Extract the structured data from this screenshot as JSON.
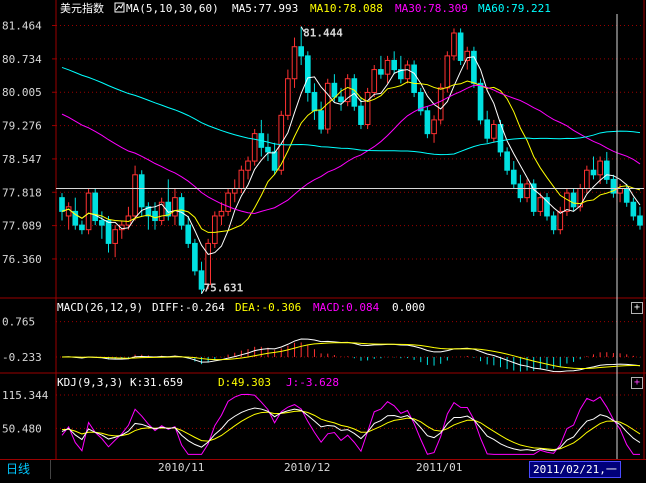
{
  "main": {
    "name": "美元指数",
    "ma_label": "MA(5,10,30,60)",
    "ma5": "MA5:77.993",
    "ma10": "MA10:78.088",
    "ma30": "MA30:78.309",
    "ma60": "MA60:79.221",
    "y_ticks": [
      "81.464",
      "80.734",
      "80.005",
      "79.276",
      "78.547",
      "77.818",
      "77.089",
      "76.360"
    ],
    "high_label": "81.444",
    "low_label": "75.631"
  },
  "macd": {
    "label": "MACD(26,12,9)",
    "diff": "DIFF:-0.264",
    "dea": "DEA:-0.306",
    "macd": "MACD:0.084",
    "extra": "0.000",
    "y_ticks": [
      "0.765",
      "-0.233"
    ]
  },
  "kdj": {
    "label": "KDJ(9,3,3)",
    "k": "K:31.659",
    "d": "D:49.303",
    "j": "J:-3.628",
    "y_ticks": [
      "115.344",
      "50.480"
    ]
  },
  "status": {
    "period": "日线",
    "x_labels": [
      "2010/11",
      "2010/12",
      "2011/01"
    ],
    "cursor_date": "2011/02/21,一"
  },
  "colors": {
    "up": "#ff3232",
    "down": "#00e0e0",
    "ma5": "#ffffff",
    "ma10": "#ffff00",
    "ma30": "#ff00ff",
    "ma60": "#00ffff",
    "grid": "#9a0000"
  },
  "chart_data": [
    {
      "type": "candlestick",
      "title": "美元指数",
      "ylim": [
        75.6,
        81.6
      ],
      "ohlc": [
        [
          77.7,
          77.8,
          77.2,
          77.4
        ],
        [
          77.3,
          77.6,
          77.0,
          77.5
        ],
        [
          77.4,
          77.7,
          77.0,
          77.1
        ],
        [
          77.1,
          77.2,
          76.9,
          77.0
        ],
        [
          77.0,
          77.9,
          76.9,
          77.8
        ],
        [
          77.8,
          77.9,
          77.1,
          77.2
        ],
        [
          77.2,
          77.4,
          76.8,
          77.1
        ],
        [
          77.2,
          77.3,
          76.5,
          76.7
        ],
        [
          76.7,
          77.1,
          76.4,
          77.0
        ],
        [
          77.0,
          77.2,
          76.8,
          77.1
        ],
        [
          77.1,
          77.5,
          77.0,
          77.3
        ],
        [
          77.3,
          78.4,
          77.2,
          78.2
        ],
        [
          78.2,
          78.3,
          77.3,
          77.5
        ],
        [
          77.5,
          77.6,
          77.0,
          77.3
        ],
        [
          77.4,
          77.6,
          77.0,
          77.2
        ],
        [
          77.2,
          77.7,
          77.1,
          77.6
        ],
        [
          77.6,
          78.1,
          77.2,
          77.3
        ],
        [
          77.3,
          77.9,
          77.1,
          77.7
        ],
        [
          77.7,
          77.8,
          77.0,
          77.1
        ],
        [
          77.1,
          77.3,
          76.6,
          76.7
        ],
        [
          76.7,
          76.8,
          76.0,
          76.1
        ],
        [
          76.1,
          76.3,
          75.6,
          75.7
        ],
        [
          75.8,
          76.8,
          75.7,
          76.7
        ],
        [
          76.7,
          77.4,
          76.6,
          77.3
        ],
        [
          77.3,
          77.6,
          77.1,
          77.4
        ],
        [
          77.4,
          77.9,
          77.3,
          77.8
        ],
        [
          77.8,
          78.1,
          77.6,
          77.9
        ],
        [
          77.9,
          78.4,
          77.8,
          78.3
        ],
        [
          78.3,
          78.6,
          78.1,
          78.5
        ],
        [
          78.5,
          79.2,
          78.4,
          79.1
        ],
        [
          79.1,
          79.4,
          78.6,
          78.8
        ],
        [
          78.8,
          79.1,
          78.5,
          78.7
        ],
        [
          78.7,
          78.9,
          78.2,
          78.3
        ],
        [
          78.3,
          79.6,
          78.2,
          79.5
        ],
        [
          79.5,
          80.5,
          79.4,
          80.3
        ],
        [
          80.3,
          81.2,
          80.1,
          81.0
        ],
        [
          81.0,
          81.44,
          80.6,
          80.8
        ],
        [
          80.8,
          80.9,
          79.8,
          80.0
        ],
        [
          80.0,
          80.2,
          79.4,
          79.6
        ],
        [
          79.6,
          79.8,
          79.1,
          79.2
        ],
        [
          79.2,
          80.3,
          79.1,
          80.2
        ],
        [
          80.2,
          80.4,
          79.8,
          79.9
        ],
        [
          79.9,
          80.1,
          79.6,
          79.8
        ],
        [
          79.8,
          80.4,
          79.7,
          80.3
        ],
        [
          80.3,
          80.4,
          79.6,
          79.7
        ],
        [
          79.7,
          79.9,
          79.2,
          79.3
        ],
        [
          79.3,
          80.1,
          79.2,
          80.0
        ],
        [
          80.0,
          80.6,
          79.9,
          80.5
        ],
        [
          80.5,
          80.8,
          80.3,
          80.4
        ],
        [
          80.4,
          80.8,
          80.2,
          80.7
        ],
        [
          80.7,
          80.9,
          80.4,
          80.5
        ],
        [
          80.5,
          80.8,
          80.2,
          80.3
        ],
        [
          80.3,
          80.7,
          80.2,
          80.6
        ],
        [
          80.6,
          80.7,
          79.9,
          80.0
        ],
        [
          80.0,
          80.1,
          79.5,
          79.6
        ],
        [
          79.6,
          79.7,
          79.0,
          79.1
        ],
        [
          79.1,
          79.5,
          78.9,
          79.4
        ],
        [
          79.4,
          80.2,
          79.3,
          80.1
        ],
        [
          80.1,
          80.9,
          80.0,
          80.8
        ],
        [
          80.8,
          81.4,
          80.7,
          81.3
        ],
        [
          81.3,
          81.4,
          80.6,
          80.7
        ],
        [
          80.7,
          81.0,
          80.5,
          80.9
        ],
        [
          80.9,
          81.0,
          80.1,
          80.2
        ],
        [
          80.2,
          80.3,
          79.3,
          79.4
        ],
        [
          79.4,
          79.6,
          78.9,
          79.0
        ],
        [
          79.0,
          79.4,
          78.9,
          79.3
        ],
        [
          79.3,
          79.4,
          78.6,
          78.7
        ],
        [
          78.7,
          78.8,
          78.2,
          78.3
        ],
        [
          78.3,
          78.5,
          77.9,
          78.0
        ],
        [
          78.0,
          78.2,
          77.6,
          77.7
        ],
        [
          77.7,
          78.1,
          77.6,
          78.0
        ],
        [
          78.0,
          78.1,
          77.3,
          77.4
        ],
        [
          77.4,
          77.8,
          77.3,
          77.7
        ],
        [
          77.7,
          77.8,
          77.2,
          77.3
        ],
        [
          77.3,
          77.4,
          76.9,
          77.0
        ],
        [
          77.0,
          77.5,
          76.9,
          77.4
        ],
        [
          77.4,
          77.9,
          77.3,
          77.8
        ],
        [
          77.8,
          77.9,
          77.4,
          77.5
        ],
        [
          77.5,
          78.0,
          77.4,
          77.9
        ],
        [
          77.9,
          78.4,
          77.8,
          78.3
        ],
        [
          78.3,
          78.6,
          78.1,
          78.2
        ],
        [
          78.2,
          78.6,
          78.0,
          78.5
        ],
        [
          78.5,
          78.7,
          78.0,
          78.1
        ],
        [
          78.1,
          78.2,
          77.7,
          77.8
        ],
        [
          77.8,
          78.0,
          77.6,
          77.9
        ],
        [
          77.9,
          78.0,
          77.5,
          77.6
        ],
        [
          77.6,
          77.7,
          77.2,
          77.3
        ],
        [
          77.3,
          77.5,
          77.0,
          77.1
        ]
      ]
    },
    {
      "type": "bar",
      "title": "MACD(26,12,9)",
      "ylim": [
        -0.6,
        0.9
      ]
    },
    {
      "type": "line",
      "title": "KDJ(9,3,3)",
      "ylim": [
        0,
        125
      ]
    }
  ]
}
